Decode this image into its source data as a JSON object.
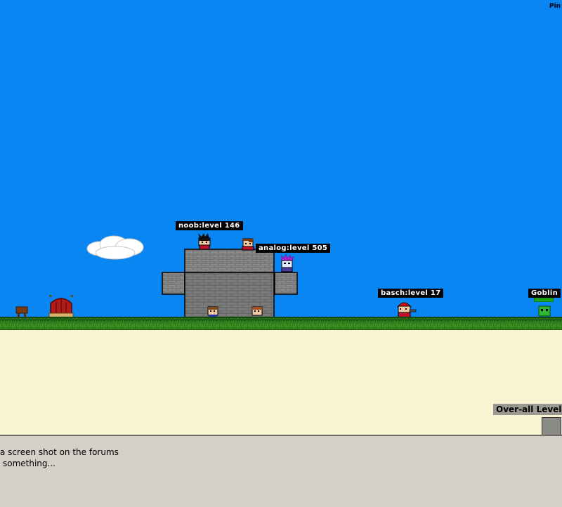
{
  "hud": {
    "ping_label": "Pin"
  },
  "players": [
    {
      "id": "noob",
      "name_tag": "noob:level 146"
    },
    {
      "id": "analog",
      "name_tag": "analog:level 505"
    },
    {
      "id": "basch",
      "name_tag": "basch:level 17"
    }
  ],
  "enemies": [
    {
      "id": "goblin",
      "name_tag": "Goblin"
    }
  ],
  "overall": {
    "label": "Over-all Level:"
  },
  "chat": {
    "lines": [
      "a screen shot on the forums",
      "something..."
    ]
  },
  "colors": {
    "sky": "#0a86f2",
    "grass": "#2f7d1c",
    "sand": "#fbf4d2",
    "stone": "#7a7a7a",
    "chat_bg": "#d4d0c8"
  }
}
